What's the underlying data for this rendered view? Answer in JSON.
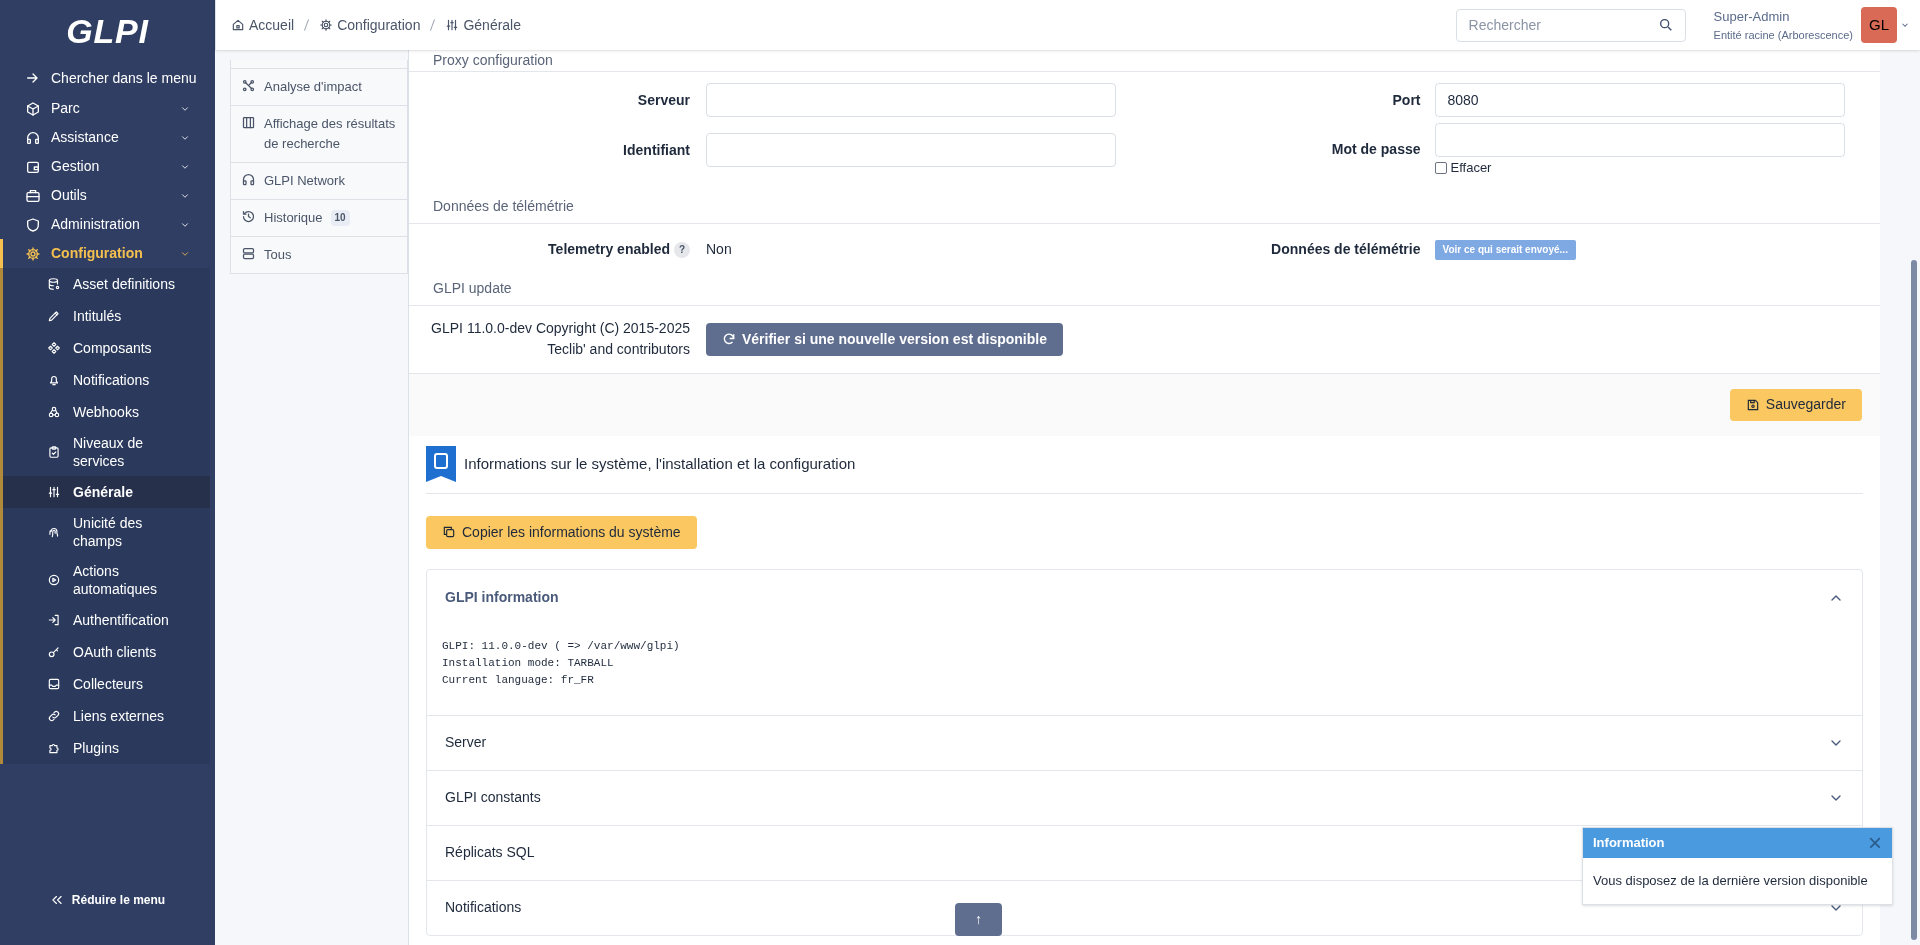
{
  "logo": "GLPI",
  "sidebar": {
    "search_label": "Chercher dans le menu",
    "items": [
      {
        "label": "Parc",
        "selected": false
      },
      {
        "label": "Assistance",
        "selected": false
      },
      {
        "label": "Gestion",
        "selected": false
      },
      {
        "label": "Outils",
        "selected": false
      },
      {
        "label": "Administration",
        "selected": false
      },
      {
        "label": "Configuration",
        "selected": true,
        "children": [
          {
            "label": "Asset definitions",
            "selected": false
          },
          {
            "label": "Intitulés",
            "selected": false
          },
          {
            "label": "Composants",
            "selected": false
          },
          {
            "label": "Notifications",
            "selected": false
          },
          {
            "label": "Webhooks",
            "selected": false
          },
          {
            "label": "Niveaux de services",
            "selected": false
          },
          {
            "label": "Générale",
            "selected": true
          },
          {
            "label": "Unicité des champs",
            "selected": false
          },
          {
            "label": "Actions automatiques",
            "selected": false
          },
          {
            "label": "Authentification",
            "selected": false
          },
          {
            "label": "OAuth clients",
            "selected": false
          },
          {
            "label": "Collecteurs",
            "selected": false
          },
          {
            "label": "Liens externes",
            "selected": false
          },
          {
            "label": "Plugins",
            "selected": false
          }
        ]
      }
    ],
    "collapse_label": "Réduire le menu"
  },
  "breadcrumb": [
    "Accueil",
    "Configuration",
    "Générale"
  ],
  "search": {
    "placeholder": "Rechercher"
  },
  "user": {
    "name": "Super-Admin",
    "entity": "Entité racine (Arborescence)",
    "initials": "GL"
  },
  "tabs": [
    {
      "label": "Analyse d'impact",
      "selected": false
    },
    {
      "label": "Affichage des résultats de recherche",
      "selected": false
    },
    {
      "label": "GLPI Network",
      "selected": false
    },
    {
      "label": "Historique",
      "count": "10",
      "selected": false
    },
    {
      "label": "Tous",
      "selected": false
    }
  ],
  "proxy": {
    "title": "Proxy configuration",
    "server_label": "Serveur",
    "port_label": "Port",
    "port_value": "8080",
    "login_label": "Identifiant",
    "password_label": "Mot de passe",
    "clear_label": "Effacer",
    "clear_checked": false
  },
  "telemetry": {
    "title": "Données de télémétrie",
    "enabled_label": "Telemetry enabled",
    "help": "?",
    "enabled_value": "Non",
    "data_label": "Données de télémétrie",
    "preview_button": "Voir ce qui serait envoyé..."
  },
  "update": {
    "title": "GLPI update",
    "copyright": "GLPI 11.0.0-dev Copyright (C) 2015-2025 Teclib' and contributors",
    "check_button": "Vérifier si une nouvelle version est disponible"
  },
  "save_button": "Sauvegarder",
  "system_info": {
    "title": "Informations sur le système, l'installation et la configuration",
    "copy_button": "Copier les informations du système",
    "sections": [
      {
        "title": "GLPI information",
        "expanded": true,
        "content": "GLPI: 11.0.0-dev ( => /var/www/glpi)\nInstallation mode: TARBALL\nCurrent language: fr_FR"
      },
      {
        "title": "Server",
        "expanded": false
      },
      {
        "title": "GLPI constants",
        "expanded": false
      },
      {
        "title": "Réplicats SQL",
        "expanded": false
      },
      {
        "title": "Notifications",
        "expanded": false
      }
    ]
  },
  "toast": {
    "title": "Information",
    "message": "Vous disposez de la dernière version disponible",
    "close": "×"
  },
  "scroll_top": "↑"
}
